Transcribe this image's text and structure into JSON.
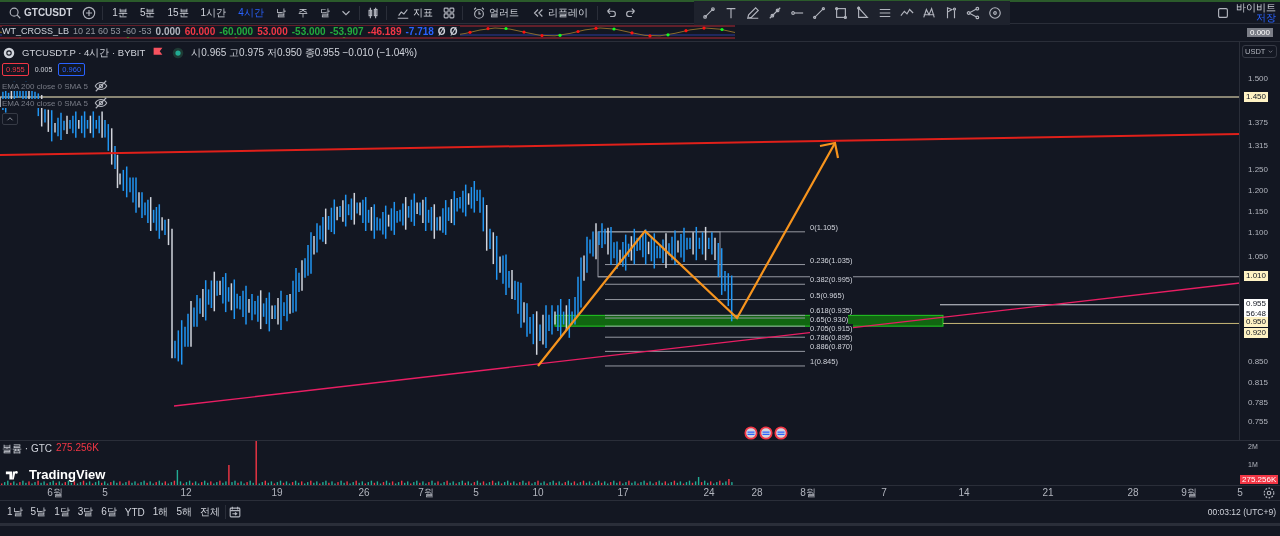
{
  "symbol_search": {
    "text": "GTCUSDT"
  },
  "intervals": [
    {
      "label": "1분",
      "selected": false
    },
    {
      "label": "5분",
      "selected": false
    },
    {
      "label": "15분",
      "selected": false
    },
    {
      "label": "1시간",
      "selected": false
    },
    {
      "label": "4시간",
      "selected": true
    },
    {
      "label": "날",
      "selected": false
    },
    {
      "label": "주",
      "selected": false
    },
    {
      "label": "달",
      "selected": false
    }
  ],
  "toolbar": {
    "indicators": "지표",
    "alerts": "얼러트",
    "replay": "리플레이"
  },
  "account": {
    "broker": "바이비트",
    "save": "저장"
  },
  "oscillator": {
    "name": "WT_CROSS_LB",
    "params": "10 21 60 53 -60 -53",
    "axis_value": "0.000",
    "values": [
      {
        "text": "0.000",
        "color": "#b2b5be"
      },
      {
        "text": "60.000",
        "color": "#f23645"
      },
      {
        "text": "-60.000",
        "color": "#22ab3d"
      },
      {
        "text": "53.000",
        "color": "#f23645"
      },
      {
        "text": "-53.000",
        "color": "#22ab3d"
      },
      {
        "text": "-53.907",
        "color": "#22ab3d"
      },
      {
        "text": "-46.189",
        "color": "#f23645"
      },
      {
        "text": "-7.718",
        "color": "#2962ff"
      },
      {
        "text": "Ø",
        "color": "#d1d4dc"
      },
      {
        "text": "Ø",
        "color": "#d1d4dc"
      }
    ]
  },
  "legend": {
    "title": "GTCUSDT.P · 4시간 · BYBIT",
    "ohlc": "시0.965 고0.975 저0.950 종0.955 −0.010 (−1.04%)",
    "sell": "0.955",
    "spread": "0.005",
    "buy": "0.960",
    "studies": [
      "EMA 200 close 0 SMA 5",
      "EMA 240 close 0 SMA 5"
    ]
  },
  "fib_levels": [
    "0(1.105)",
    "0.236(1.035)",
    "0.382(0.995)",
    "0.5(0.965)",
    "0.618(0.935)",
    "0.65(0.930)",
    "0.705(0.915)",
    "0.786(0.895)",
    "0.886(0.870)",
    "1(0.845)"
  ],
  "price_axis": {
    "currency": "USDT",
    "ticks": [
      "1.500",
      "1.375",
      "1.315",
      "1.250",
      "1.200",
      "1.150",
      "1.100",
      "1.050",
      "0.850",
      "0.815",
      "0.785",
      "0.755"
    ],
    "tags": [
      {
        "kind": "line",
        "text": "1.450"
      },
      {
        "kind": "line",
        "text": "1.010"
      },
      {
        "kind": "last",
        "text": "0.955",
        "countdown": "56:48"
      },
      {
        "kind": "line",
        "text": "0.950"
      },
      {
        "kind": "line",
        "text": "0.920"
      }
    ]
  },
  "volume": {
    "label": "볼륨 · GTC",
    "value": "275.256K",
    "ticks": [
      "2M",
      "1M"
    ],
    "tag": "275.256K"
  },
  "brand": "TradingView",
  "time_axis": [
    "6월",
    "5",
    "12",
    "19",
    "26",
    "7월",
    "5",
    "10",
    "17",
    "24",
    "28",
    "8월",
    "7",
    "14",
    "21",
    "28",
    "9월",
    "5"
  ],
  "ranges": [
    "1날",
    "5날",
    "1달",
    "3달",
    "6달",
    "YTD",
    "1해",
    "5해",
    "전체"
  ],
  "clock": "00:03:12 (UTC+9)"
}
